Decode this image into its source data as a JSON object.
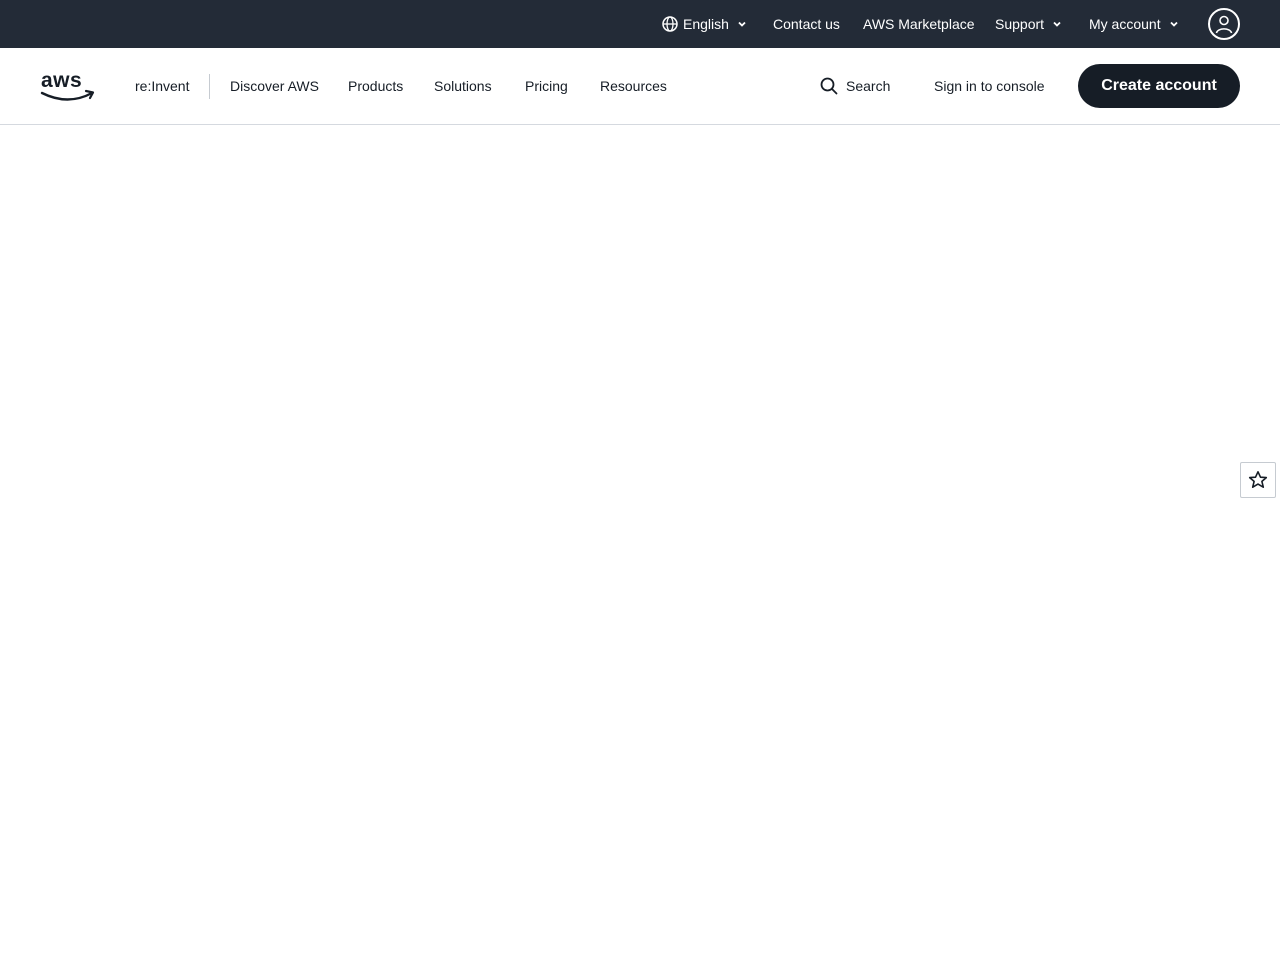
{
  "utility_bar": {
    "language_label": "English",
    "contact_label": "Contact us",
    "marketplace_label": "AWS Marketplace",
    "support_label": "Support",
    "account_label": "My account"
  },
  "main_nav": {
    "logo_icon": "aws-logo-icon",
    "items": [
      {
        "label": "re:Invent"
      },
      {
        "label": "Discover AWS"
      },
      {
        "label": "Products"
      },
      {
        "label": "Solutions"
      },
      {
        "label": "Pricing"
      },
      {
        "label": "Resources"
      }
    ],
    "search_label": "Search",
    "sign_in_label": "Sign in to console",
    "create_account_label": "Create account"
  },
  "colors": {
    "utility_bg": "#232b37",
    "primary_button": "#161d26",
    "text_dark": "#161d26"
  }
}
